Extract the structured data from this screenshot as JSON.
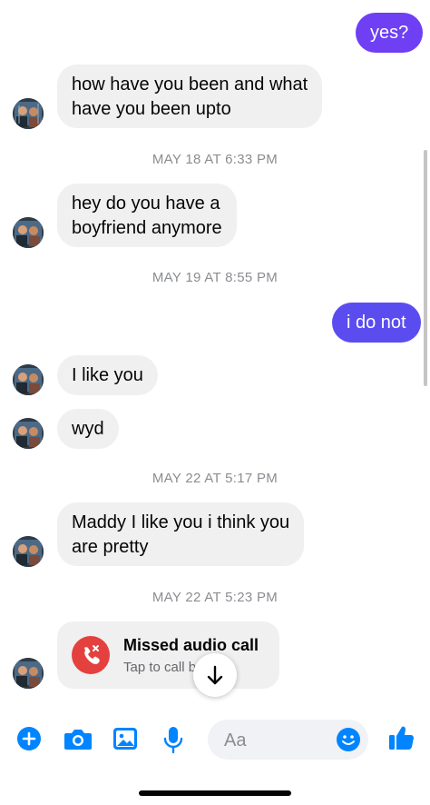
{
  "colors": {
    "accent": "#0084ff",
    "outgoing_gradient_start": "#6a3df0",
    "outgoing_gradient_end": "#5b4cf0",
    "incoming_bg": "#f0f0f0",
    "missed_call_red": "#e4403e"
  },
  "messages": [
    {
      "type": "outgoing",
      "text": "yes?"
    },
    {
      "type": "incoming",
      "lines": [
        "how have you been and what",
        "have you been upto"
      ]
    },
    {
      "type": "timestamp",
      "text": "MAY 18 AT 6:33 PM"
    },
    {
      "type": "incoming",
      "lines": [
        "hey do you have a",
        "boyfriend anymore"
      ]
    },
    {
      "type": "timestamp",
      "text": "MAY 19 AT 8:55 PM"
    },
    {
      "type": "outgoing",
      "text": "i do not"
    },
    {
      "type": "incoming",
      "text": "I like you"
    },
    {
      "type": "incoming",
      "text": "wyd"
    },
    {
      "type": "timestamp",
      "text": "MAY 22 AT 5:17 PM"
    },
    {
      "type": "incoming",
      "lines": [
        "Maddy I like you i think you",
        "are pretty"
      ]
    },
    {
      "type": "timestamp",
      "text": "MAY 22 AT 5:23 PM"
    },
    {
      "type": "missed_call",
      "title": "Missed audio call",
      "subtitle": "Tap to call back"
    }
  ],
  "composer": {
    "placeholder": "Aa"
  },
  "toolbar": {
    "icons": [
      "plus-icon",
      "camera-icon",
      "gallery-icon",
      "microphone-icon",
      "emoji-icon",
      "thumbs-up-icon"
    ]
  }
}
